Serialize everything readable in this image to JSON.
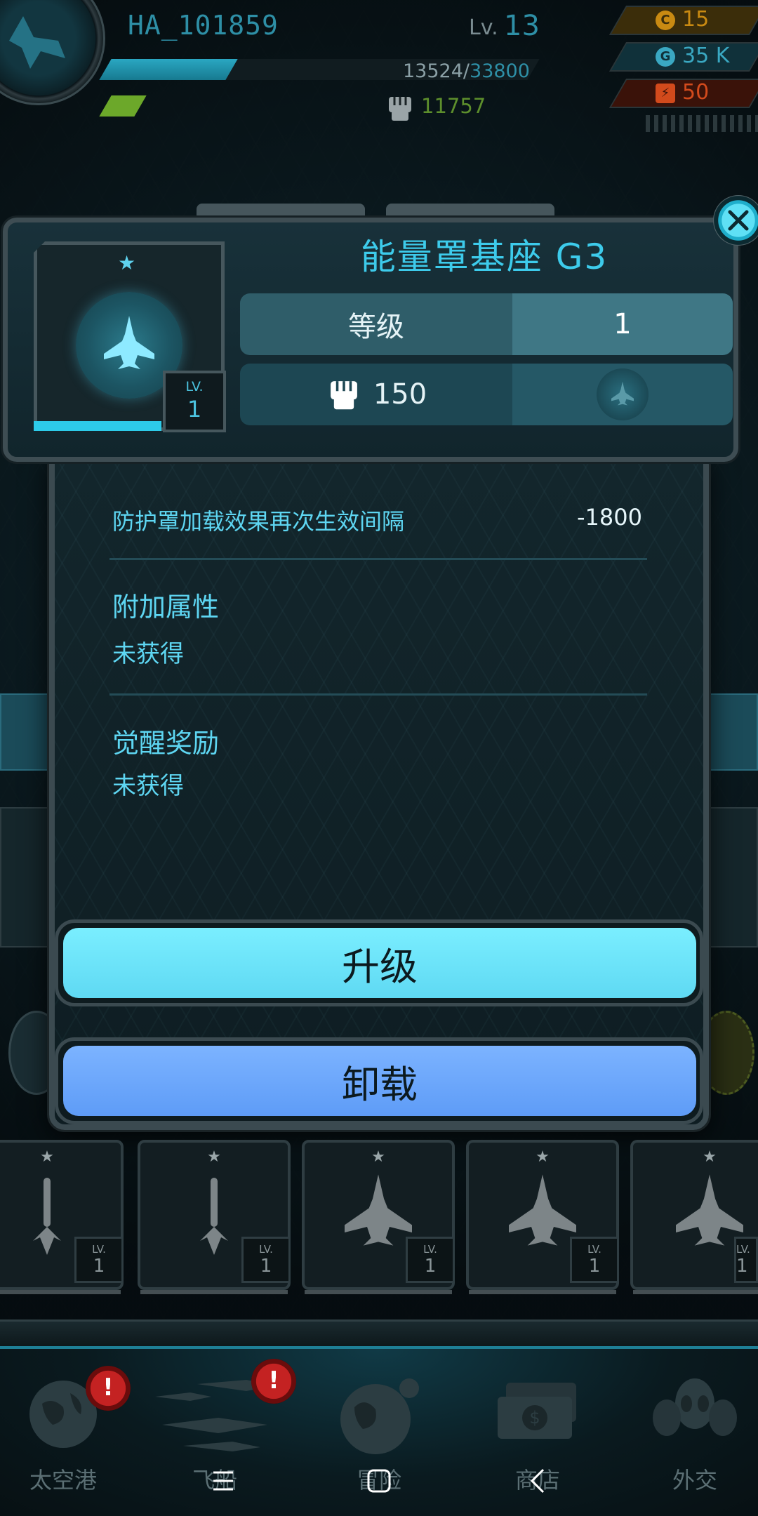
{
  "player": {
    "name": "HA_101859",
    "level_prefix": "Lv.",
    "level": "13",
    "xp_current": "13524",
    "xp_separator": "/",
    "xp_max": "33800",
    "power": "11757"
  },
  "resources": [
    {
      "icon": "gold-coin-icon",
      "value": "15",
      "color": "#c98a12"
    },
    {
      "icon": "gem-icon",
      "value": "35 K",
      "color": "#3aa8c2"
    },
    {
      "icon": "energy-icon",
      "value": "50",
      "color": "#d24a1c"
    }
  ],
  "item": {
    "title": "能量罩基座 G3",
    "level_label": "LV.",
    "level_value": "1",
    "stat_level_label": "等级",
    "stat_level_value": "1",
    "power_value": "150"
  },
  "details": {
    "effect_label": "防护罩加载效果再次生效间隔",
    "effect_value": "-1800",
    "extra_title": "附加属性",
    "extra_status": "未获得",
    "awaken_title": "觉醒奖励",
    "awaken_status": "未获得"
  },
  "actions": {
    "upgrade_label": "升级",
    "unload_label": "卸载"
  },
  "inventory": [
    {
      "lv_label": "LV.",
      "lv_value": "1",
      "icon": "missile-icon"
    },
    {
      "lv_label": "LV.",
      "lv_value": "1",
      "icon": "missile-icon"
    },
    {
      "lv_label": "LV.",
      "lv_value": "1",
      "icon": "fighter-ship-icon"
    },
    {
      "lv_label": "LV.",
      "lv_value": "1",
      "icon": "fighter-ship-icon"
    },
    {
      "lv_label": "LV.",
      "lv_value": "1",
      "icon": "fighter-ship-icon"
    }
  ],
  "nav": {
    "spaceport": "太空港",
    "ships": "飞船",
    "adventure": "冒险",
    "shop": "商店",
    "diplomacy": "外交",
    "badge": "!"
  },
  "colors": {
    "accent_cyan": "#3dcbeb",
    "upgrade_button": "#6fe6fb",
    "unload_button": "#6aa8fb"
  }
}
